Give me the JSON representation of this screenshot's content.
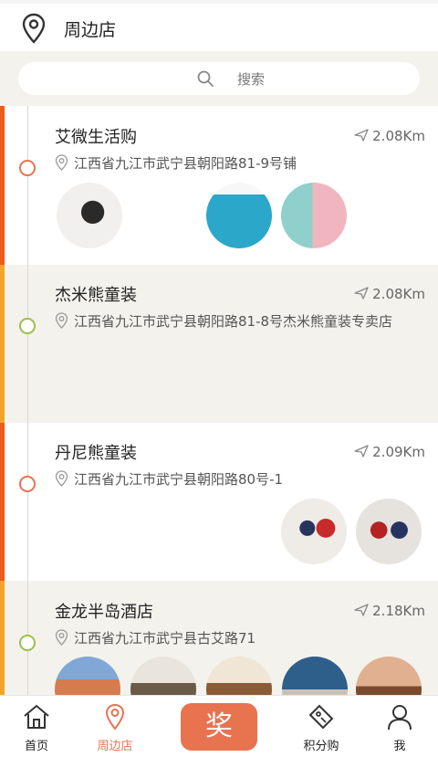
{
  "header": {
    "title": "周边店",
    "icon": "location-pin-icon"
  },
  "search": {
    "placeholder": "搜索",
    "icon": "search-icon"
  },
  "colors": {
    "accent": "#e8734f",
    "orange_bar": "#f05a1a",
    "yellow_bar": "#f3a52a",
    "green_dot": "#9bc04a",
    "orange_dot": "#e8734f"
  },
  "stores": [
    {
      "name": "艾微生活购",
      "distance": "2.08Km",
      "address": "江西省九江市武宁县朝阳路81-9号铺",
      "photos": 4
    },
    {
      "name": "杰米熊童装",
      "distance": "2.08Km",
      "address": "江西省九江市武宁县朝阳路81-8号杰米熊童装专卖店",
      "photos": 0
    },
    {
      "name": "丹尼熊童装",
      "distance": "2.09Km",
      "address": "江西省九江市武宁县朝阳路80号-1",
      "photos": 2
    },
    {
      "name": "金龙半岛酒店",
      "distance": "2.18Km",
      "address": "江西省九江市武宁县古艾路71",
      "photos": 5
    }
  ],
  "tabbar": {
    "home": "首页",
    "nearby": "周边店",
    "award": "奖",
    "points": "积分购",
    "me": "我"
  }
}
